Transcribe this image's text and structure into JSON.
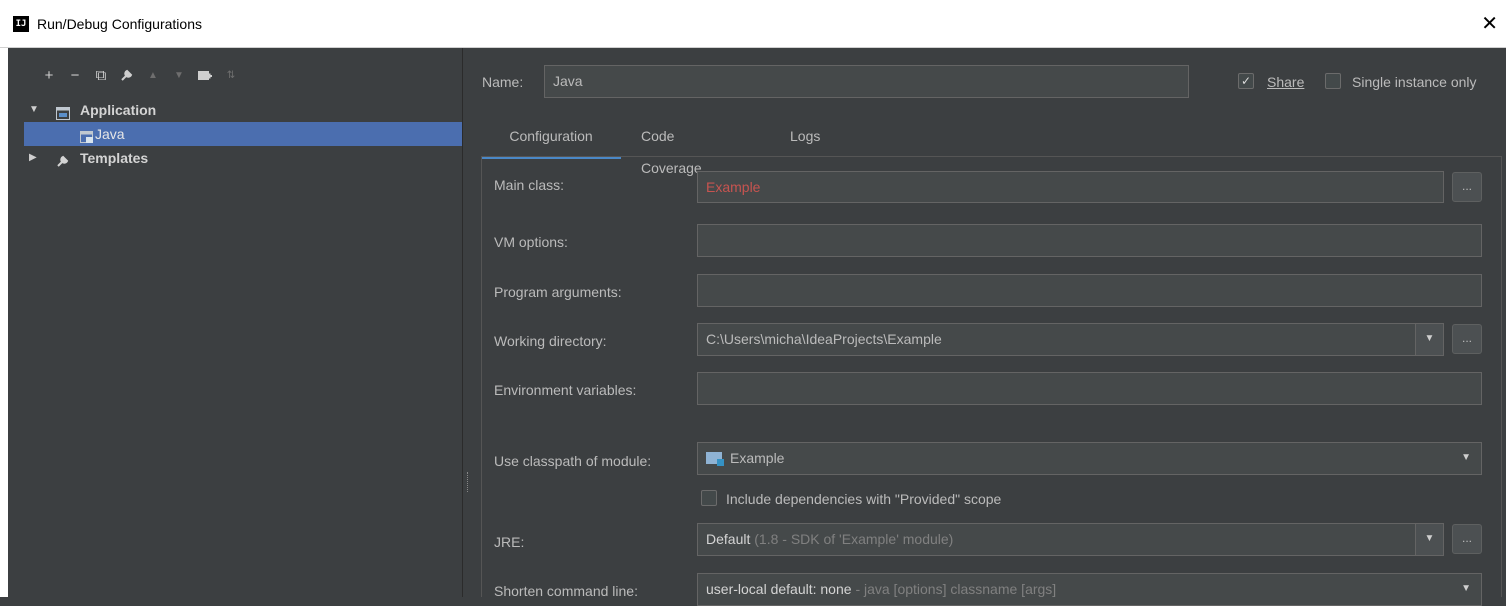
{
  "window": {
    "title": "Run/Debug Configurations",
    "close_glyph": "✕",
    "app_icon_text": "IJ"
  },
  "toolbar": {
    "buttons": [
      {
        "name": "add-icon",
        "glyph": "+"
      },
      {
        "name": "remove-icon",
        "glyph": "−"
      },
      {
        "name": "copy-icon",
        "glyph": "⧉"
      },
      {
        "name": "wrench-icon",
        "glyph": "🔧"
      },
      {
        "name": "move-up-icon",
        "glyph": "▲"
      },
      {
        "name": "move-down-icon",
        "glyph": "▼"
      },
      {
        "name": "new-folder-icon",
        "glyph": "▆"
      },
      {
        "name": "sort-icon",
        "glyph": "⇅"
      }
    ]
  },
  "tree": {
    "application_label": "Application",
    "java_label": "Java",
    "templates_label": "Templates",
    "expanded_arrow": "▼",
    "collapsed_arrow": "▶"
  },
  "header": {
    "name_label": "Name:",
    "name_value": "Java",
    "share_label": "Share",
    "share_checked": true,
    "single_instance_label": "Single instance only",
    "single_instance_checked": false
  },
  "tabs": [
    {
      "label": "Configuration",
      "active": true
    },
    {
      "label": "Code Coverage",
      "active": false
    },
    {
      "label": "Logs",
      "active": false
    }
  ],
  "form": {
    "main_class_label": "Main class:",
    "main_class_value": "Example",
    "vm_options_label": "VM options:",
    "vm_options_value": "",
    "program_args_label": "Program arguments:",
    "program_args_value": "",
    "working_dir_label": "Working directory:",
    "working_dir_value": "C:\\Users\\micha\\IdeaProjects\\Example",
    "env_vars_label": "Environment variables:",
    "env_vars_value": "",
    "classpath_label": "Use classpath of module:",
    "classpath_value": "Example",
    "include_deps_label": "Include dependencies with \"Provided\" scope",
    "include_deps_checked": false,
    "jre_label": "JRE:",
    "jre_value": "Default",
    "jre_hint": "(1.8 - SDK of 'Example' module)",
    "shorten_label": "Shorten command line:",
    "shorten_value": "user-local default: none",
    "shorten_hint": "- java [options] classname [args]",
    "browse_label": "...",
    "dropdown_glyph": "▼"
  },
  "colors": {
    "background": "#3c3f41",
    "selection": "#4b6eaf",
    "error_text": "#c75450",
    "tab_underline": "#4a88c7"
  }
}
